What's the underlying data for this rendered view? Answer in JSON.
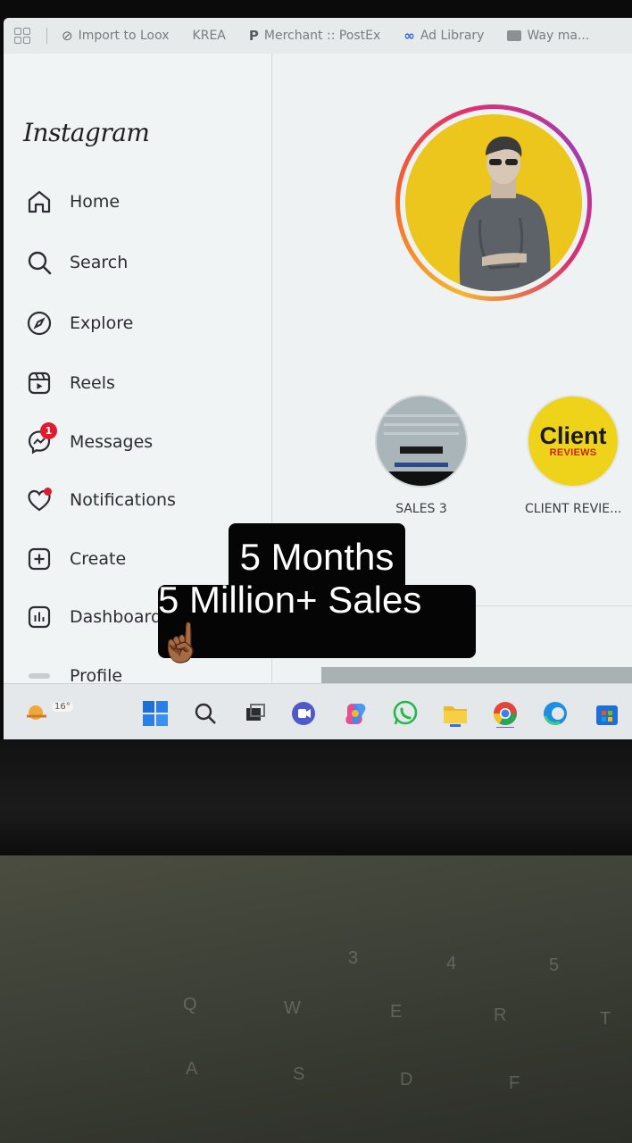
{
  "bookmarks": {
    "items": [
      {
        "label": "Import to Loox"
      },
      {
        "label": "KREA"
      },
      {
        "label": "Merchant :: PostEx"
      },
      {
        "label": "Ad Library"
      },
      {
        "label": "Way ma..."
      }
    ]
  },
  "sidebar": {
    "logo": "Instagram",
    "items": [
      {
        "label": "Home",
        "icon": "home-icon"
      },
      {
        "label": "Search",
        "icon": "search-icon"
      },
      {
        "label": "Explore",
        "icon": "compass-icon"
      },
      {
        "label": "Reels",
        "icon": "reels-icon"
      },
      {
        "label": "Messages",
        "icon": "messenger-icon",
        "badge": "1"
      },
      {
        "label": "Notifications",
        "icon": "heart-icon"
      },
      {
        "label": "Create",
        "icon": "plus-square-icon"
      },
      {
        "label": "Dashboard",
        "icon": "bar-chart-icon"
      },
      {
        "label": "Profile",
        "icon": "profile-avatar-icon"
      }
    ]
  },
  "profile": {
    "highlights": [
      {
        "label": "SALES 3"
      },
      {
        "label": "CLIENT REVIE...",
        "cover_title": "Client",
        "cover_subtitle": "REVIEWS"
      }
    ]
  },
  "taskbar": {
    "weather_temp": "16°",
    "apps": [
      "windows-start-icon",
      "search-icon",
      "task-view-icon",
      "teams-icon",
      "copilot-icon",
      "whatsapp-icon",
      "file-explorer-icon",
      "chrome-icon",
      "edge-icon",
      "microsoft-store-icon"
    ]
  },
  "overlay": {
    "line1": "5 Months",
    "line2": "5 Million+ Sales ☝🏾"
  },
  "colors": {
    "ig_gradient": [
      "#f7b62b",
      "#e1306c",
      "#a43bb0"
    ],
    "avatar_bg": "#ecc61c",
    "badge": "#e21a2f",
    "caption_bg": "#050505"
  }
}
